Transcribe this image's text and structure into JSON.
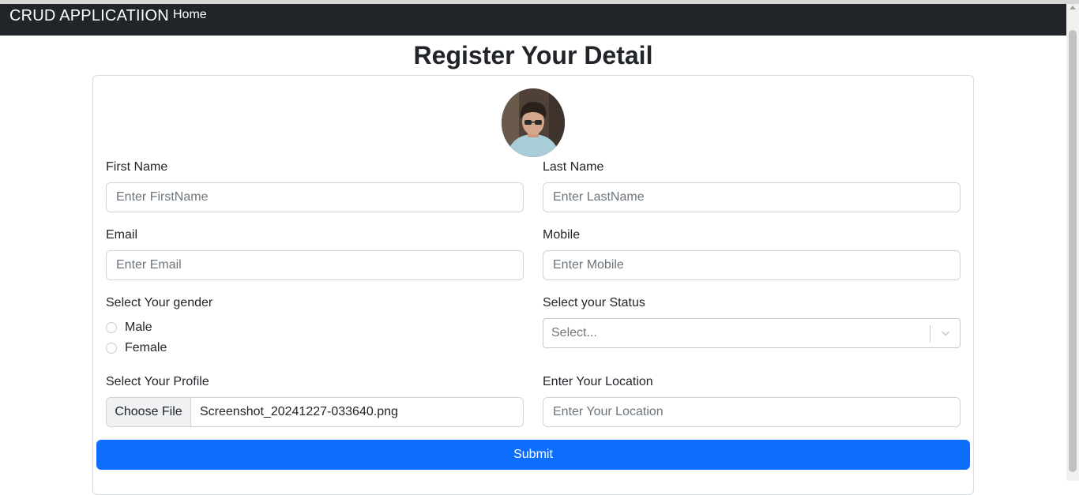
{
  "navbar": {
    "brand": "CRUD APPLICATIION",
    "home_label": "Home"
  },
  "page": {
    "title": "Register Your Detail"
  },
  "form": {
    "first_name": {
      "label": "First Name",
      "placeholder": "Enter FirstName"
    },
    "last_name": {
      "label": "Last Name",
      "placeholder": "Enter LastName"
    },
    "email": {
      "label": "Email",
      "placeholder": "Enter Email"
    },
    "mobile": {
      "label": "Mobile",
      "placeholder": "Enter Mobile"
    },
    "gender": {
      "label": "Select Your gender",
      "options": [
        "Male",
        "Female"
      ]
    },
    "status": {
      "label": "Select your Status",
      "placeholder": "Select..."
    },
    "profile": {
      "label": "Select Your Profile",
      "button_label": "Choose File",
      "file_name": "Screenshot_20241227-033640.png"
    },
    "location": {
      "label": "Enter Your Location",
      "placeholder": "Enter Your Location"
    },
    "submit_label": "Submit"
  },
  "colors": {
    "navbar_bg": "#212529",
    "primary": "#0d6efd"
  }
}
